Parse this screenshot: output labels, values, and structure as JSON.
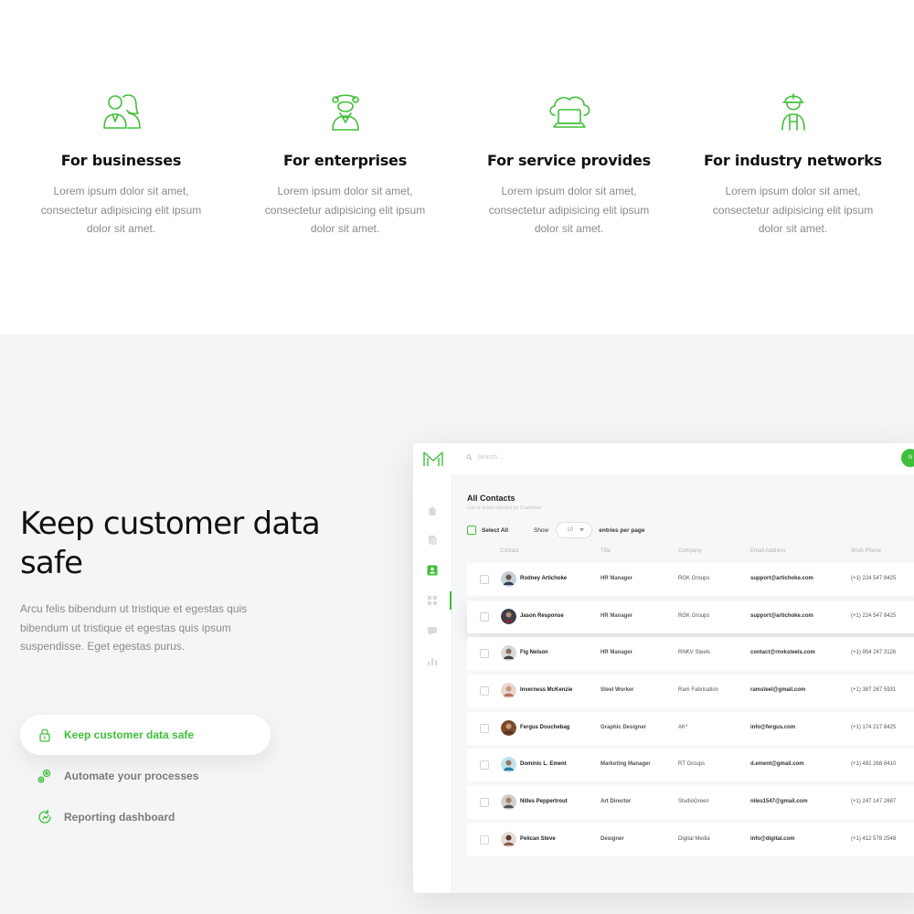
{
  "features": [
    {
      "icon": "business-people-icon",
      "title": "For businesses",
      "text": "Lorem ipsum dolor sit amet, consectetur adipisicing elit ipsum dolor sit amet."
    },
    {
      "icon": "enterprise-person-icon",
      "title": "For enterprises",
      "text": "Lorem ipsum dolor sit amet, consectetur adipisicing elit ipsum dolor sit amet."
    },
    {
      "icon": "cloud-laptop-icon",
      "title": "For service provides",
      "text": "Lorem ipsum dolor sit amet, consectetur adipisicing elit ipsum dolor sit amet."
    },
    {
      "icon": "industry-worker-icon",
      "title": "For industry networks",
      "text": "Lorem ipsum dolor sit amet, consectetur adipisicing elit ipsum dolor sit amet."
    }
  ],
  "section": {
    "heading": "Keep customer data safe",
    "lead": "Arcu felis bibendum ut tristique et egestas quis bibendum ut tristique et egestas quis ipsum suspendisse. Eget egestas purus.",
    "tabs": [
      {
        "label": "Keep customer data safe",
        "icon": "lock-icon",
        "active": true
      },
      {
        "label": "Automate your processes",
        "icon": "gears-icon",
        "active": false
      },
      {
        "label": "Reporting dashboard",
        "icon": "refresh-chart-icon",
        "active": false
      }
    ]
  },
  "app": {
    "search_placeholder": "Search ...",
    "top_button": "N",
    "title": "All Contacts",
    "subtitle": "List of ticket opened by Customer",
    "select_all": "Select All",
    "show_label": "Show",
    "entries_value": "10",
    "entries_suffix": "entries per page",
    "columns": [
      "Contact",
      "Title",
      "Company",
      "Email Address",
      "Work Phone"
    ],
    "rows": [
      {
        "name": "Rodney Artichoke",
        "title": "HR Manager",
        "company": "RGK Groups",
        "email": "support@artichoke.com",
        "phone": "(+1) 224 547 8425"
      },
      {
        "name": "Jason Response",
        "title": "HR Manager",
        "company": "RGK Groups",
        "email": "support@artichoke.com",
        "phone": "(+1) 224 547 8425"
      },
      {
        "name": "Fig Nelson",
        "title": "HR Manager",
        "company": "RNKV Steels",
        "email": "contact@rnvksteels.com",
        "phone": "(+1) 954 247 3126"
      },
      {
        "name": "Inverness McKenzie",
        "title": "Steel Worker",
        "company": "Ram Fabrication",
        "email": "ramsteel@gmail.com",
        "phone": "(+1) 387 267 5931"
      },
      {
        "name": "Fergus Douchebag",
        "title": "Graphic Designer",
        "company": "AK*",
        "email": "info@fergus.com",
        "phone": "(+1) 174 217 8425"
      },
      {
        "name": "Dominic L. Ement",
        "title": "Marketing Manager",
        "company": "RT Groups",
        "email": "d.ement@gmail.com",
        "phone": "(+1) 482 268 8410"
      },
      {
        "name": "Nilles Peppertrout",
        "title": "Art Director",
        "company": "StudioGreen",
        "email": "niles1547@gmail.com",
        "phone": "(+1) 247 147 2687"
      },
      {
        "name": "Pelican Steve",
        "title": "Designer",
        "company": "Digital Media",
        "email": "info@digital.com",
        "phone": "(+1) 412 578 2548"
      }
    ]
  },
  "colors": {
    "accent": "#3fbf3a",
    "section_bg": "#f4f5f7",
    "muted_text": "#8a8a8a"
  }
}
